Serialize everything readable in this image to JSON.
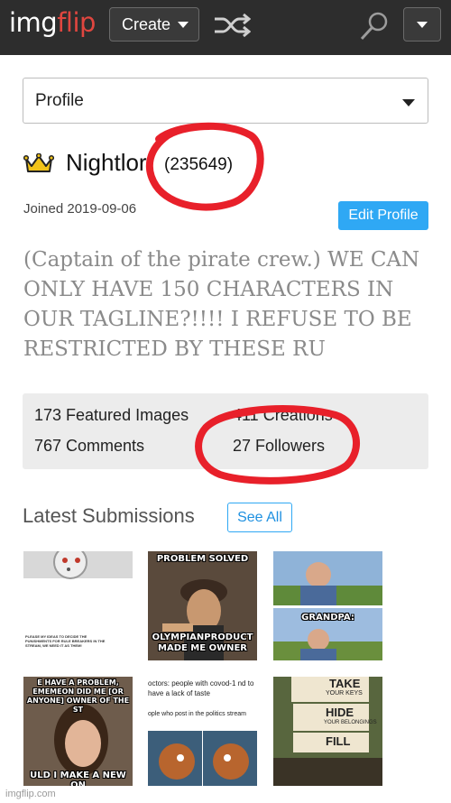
{
  "header": {
    "logo_part1": "img",
    "logo_part2": "flip",
    "create_label": "Create",
    "shuffle_icon": "shuffle-icon",
    "search_icon": "search-icon"
  },
  "profile_select": {
    "value": "Profile"
  },
  "user": {
    "username": "Nightlor",
    "points": "(235649)",
    "joined": "Joined 2019-09-06",
    "edit_label": "Edit Profile",
    "tagline": "(Captain of the pirate crew.) WE CAN ONLY HAVE 150 CHARACTERS IN OUR TAGLINE?!!!! I REFUSE TO BE RESTRICTED BY THESE RU"
  },
  "stats": {
    "featured": "173 Featured Images",
    "creations": "411 Creations",
    "comments": "767 Comments",
    "followers": "27 Followers"
  },
  "latest": {
    "title": "Latest Submissions",
    "see_all": "See All"
  },
  "thumbs": {
    "t1_text": "PLEASE MY IDEAS TO DECIDE THE PUNISHMENTS FOR RULE BREAKERS IN THE STREAM, WE NEED IT AS THEM!",
    "t2_top": "PROBLEM SOLVED",
    "t2_bottom": "OLYMPIANPRODUCT MADE ME OWNER",
    "t3_text": "GRANDPA:",
    "t4_top": "E HAVE A PROBLEM, EMEMEON DID ME [OR ANYONE] OWNER OF THE ST",
    "t4_bottom": "ULD I MAKE A NEW ON",
    "t5_top": "octors: people with covod-1 nd to have a lack of taste",
    "t5_mid": "ople who post in the politics stream",
    "t6_sign1": "TAKE",
    "t6_sign1b": "YOUR KEYS",
    "t6_sign2": "HIDE",
    "t6_sign2b": "YOUR BELONGINGS",
    "t6_sign3": "FILL"
  },
  "footer": {
    "watermark": "imgflip.com"
  },
  "colors": {
    "topbar": "#2d2d2d",
    "accent": "#2fa8f4",
    "logo_red": "#e0463f",
    "annotation": "#e8202a"
  }
}
